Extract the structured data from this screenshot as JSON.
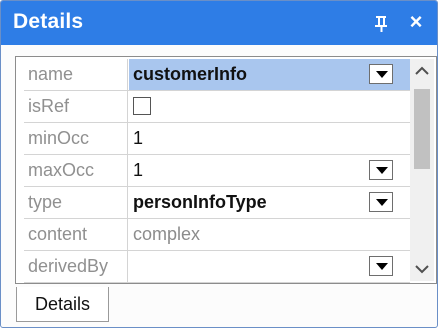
{
  "window": {
    "title": "Details",
    "pin_icon": "pin-icon",
    "close_glyph": "×",
    "close_icon": "close-icon"
  },
  "properties": [
    {
      "name": "name",
      "value": "customerInfo",
      "selected": true,
      "dropdown": true
    },
    {
      "name": "isRef",
      "value": "",
      "checkbox": true,
      "checked": false
    },
    {
      "name": "minOcc",
      "value": "1"
    },
    {
      "name": "maxOcc",
      "value": "1",
      "dropdown": true
    },
    {
      "name": "type",
      "value": "personInfoType",
      "dropdown": true
    },
    {
      "name": "content",
      "value": "complex",
      "readonly": true
    },
    {
      "name": "derivedBy",
      "value": "",
      "dropdown": true
    }
  ],
  "tabs": [
    {
      "label": "Details",
      "active": true
    }
  ],
  "colors": {
    "titlebar": "#2e7de6",
    "selection": "#a9c6ee",
    "label_text": "#909090"
  }
}
